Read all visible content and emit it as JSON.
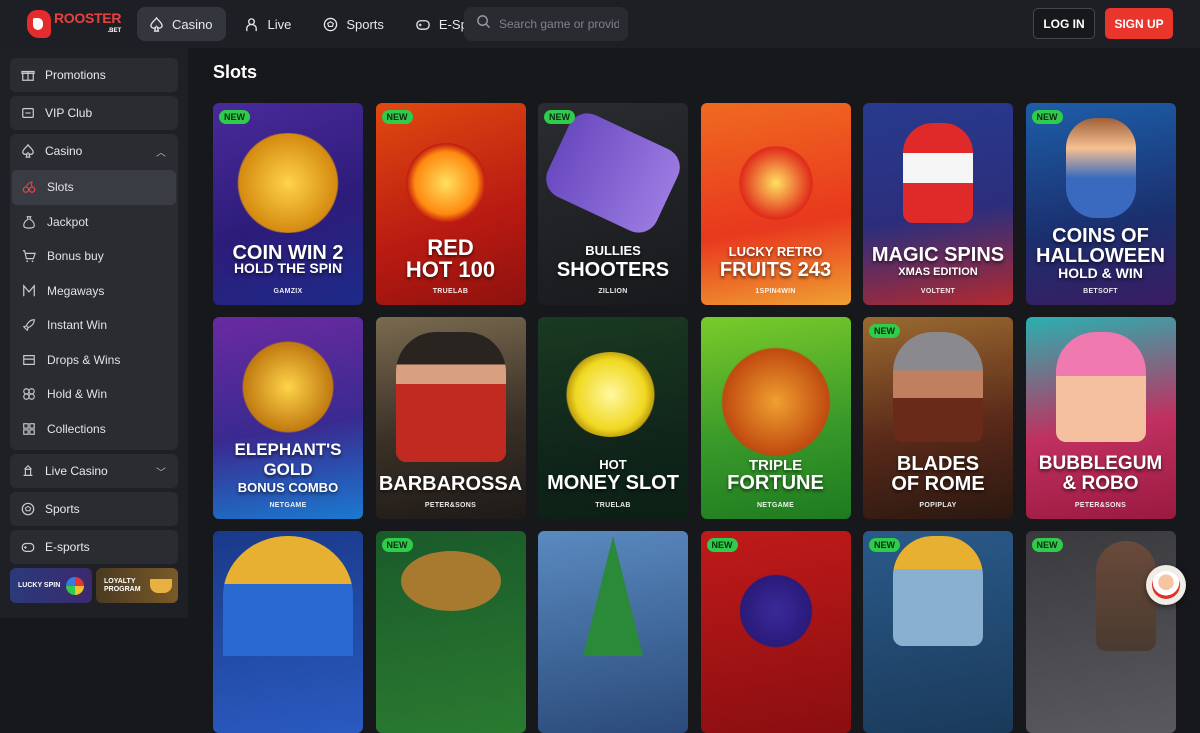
{
  "brand": {
    "name": "ROOSTER",
    "suffix": ".BET"
  },
  "nav": [
    {
      "label": "Casino",
      "icon": "spade-icon",
      "active": true
    },
    {
      "label": "Live",
      "icon": "dealer-icon"
    },
    {
      "label": "Sports",
      "icon": "football-icon"
    },
    {
      "label": "E-Sports",
      "icon": "gamepad-icon"
    }
  ],
  "search": {
    "placeholder": "Search game or provider"
  },
  "auth": {
    "login": "LOG IN",
    "signup": "SIGN UP"
  },
  "sidebar": {
    "top": [
      {
        "label": "Promotions",
        "icon": "gift-icon"
      },
      {
        "label": "VIP Club",
        "icon": "crown-icon"
      }
    ],
    "casino": {
      "label": "Casino",
      "icon": "spade-icon",
      "items": [
        {
          "label": "Slots",
          "icon": "cherries-icon",
          "active": true
        },
        {
          "label": "Jackpot",
          "icon": "moneybag-icon"
        },
        {
          "label": "Bonus buy",
          "icon": "cart-icon"
        },
        {
          "label": "Megaways",
          "icon": "megaways-icon"
        },
        {
          "label": "Instant Win",
          "icon": "rocket-icon"
        },
        {
          "label": "Drops & Wins",
          "icon": "drops-icon"
        },
        {
          "label": "Hold & Win",
          "icon": "hold-icon"
        },
        {
          "label": "Collections",
          "icon": "collections-icon"
        }
      ]
    },
    "bottom": [
      {
        "label": "Live Casino",
        "icon": "live-casino-icon"
      },
      {
        "label": "Sports",
        "icon": "football-icon"
      },
      {
        "label": "E-sports",
        "icon": "gamepad-icon"
      }
    ],
    "promos": [
      {
        "label": "LUCKY SPIN"
      },
      {
        "label": "LOYALTY PROGRAM"
      }
    ]
  },
  "main": {
    "title": "Slots"
  },
  "colors": {
    "accent": "#e8362d",
    "new_badge": "#2fcb4b",
    "bg": "#17181c",
    "panel": "#1f2025"
  },
  "games": [
    {
      "name1": "COIN WIN 2",
      "name2": "HOLD THE SPIN",
      "provider": "GAMZIX",
      "new": true,
      "badge": "NEW",
      "bg": "linear-gradient(160deg,#4a2a9a,#2d1c7a 55%,#1e2a88)"
    },
    {
      "name1": "RED",
      "name2": "HOT 100",
      "provider": "TRUELAB",
      "new": true,
      "badge": "NEW",
      "bg": "linear-gradient(160deg,#e04a10,#b81a12 60%,#8e120e)"
    },
    {
      "name1": "BULLIES",
      "name2": "SHOOTERS",
      "provider": "ZILLION",
      "new": true,
      "badge": "NEW",
      "bg": "linear-gradient(160deg,#2a2c30,#17191d)"
    },
    {
      "name1": "LUCKY RETRO",
      "name2": "FRUITS 243",
      "provider": "1SPIN4WIN",
      "new": false,
      "bg": "linear-gradient(170deg,#f06a20,#e8381e 60%,#f0a032)"
    },
    {
      "name1": "MAGIC SPINS",
      "name2": "XMAS EDITION",
      "provider": "VOLTENT",
      "new": false,
      "bg": "linear-gradient(170deg,#283a8e,#2c2e7c 55%,#b22a30)"
    },
    {
      "name1": "COINS OF",
      "name2": "HALLOWEEN",
      "name3": "HOLD & WIN",
      "provider": "BETSOFT",
      "new": true,
      "badge": "NEW",
      "bg": "linear-gradient(170deg,#1d5ea8,#1b2f6e 60%,#3a1c62)"
    },
    {
      "name1": "ELEPHANT'S",
      "name2": "GOLD",
      "name3": "BONUS COMBO",
      "provider": "NETGAME",
      "new": false,
      "bg": "linear-gradient(170deg,#6a2aa0,#3a2a90 55%,#1a7ad0)"
    },
    {
      "name1": "BARBAROSSA",
      "provider": "PETER&SONS",
      "new": false,
      "bg": "linear-gradient(170deg,#7a6a50,#3a3026 55%,#1e1a18)"
    },
    {
      "name1": "HOT",
      "name2": "MONEY SLOT",
      "provider": "TRUELAB",
      "new": false,
      "bg": "linear-gradient(170deg,#1a3a22,#10261a 60%,#0c1f14)"
    },
    {
      "name1": "TRIPLE",
      "name2": "FORTUNE",
      "provider": "NETGAME",
      "new": false,
      "bg": "linear-gradient(170deg,#7acb2a,#3a9a2a 55%,#1e7a20)"
    },
    {
      "name1": "BLADES",
      "name2": "OF ROME",
      "provider": "POPIPLAY",
      "new": true,
      "badge": "NEW",
      "bg": "linear-gradient(170deg,#9a6a30,#5a2a1a 55%,#2a1810)"
    },
    {
      "name1": "BUBBLEGUM",
      "name2": "& ROBO",
      "provider": "PETER&SONS",
      "new": false,
      "bg": "linear-gradient(170deg,#2ab0b0,#c03060 55%,#9a1a40)"
    },
    {
      "new": false,
      "bg": "linear-gradient(170deg,#1a3a8a,#2a5ac0)"
    },
    {
      "new": true,
      "badge": "NEW",
      "bg": "linear-gradient(170deg,#1a5a2a,#2a7a30)"
    },
    {
      "new": false,
      "bg": "linear-gradient(170deg,#5a8ac0,#2a4a7a)"
    },
    {
      "new": true,
      "badge": "NEW",
      "bg": "linear-gradient(170deg,#c01a1a,#8a0e10)"
    },
    {
      "new": true,
      "badge": "NEW",
      "bg": "linear-gradient(170deg,#2a5a8a,#1a3a5a)"
    },
    {
      "new": true,
      "badge": "NEW",
      "bg": "linear-gradient(170deg,#3a3a3e,#5a5a5e)"
    }
  ]
}
